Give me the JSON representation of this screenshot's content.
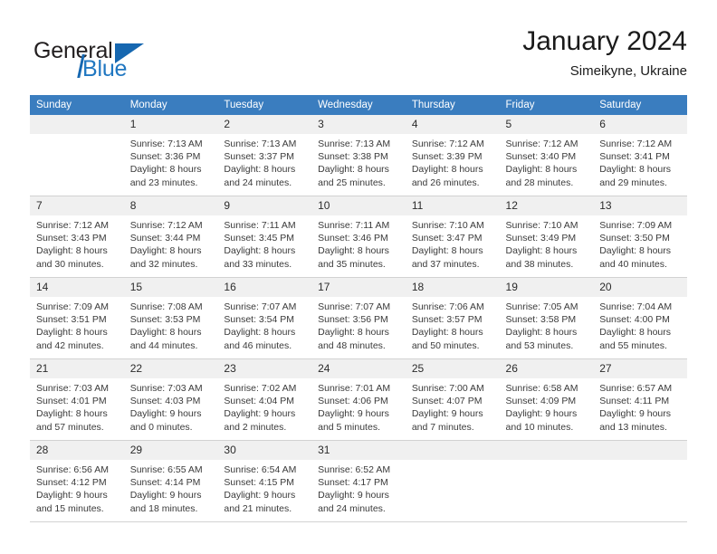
{
  "brand": {
    "name_top": "General",
    "name_bottom": "Blue",
    "accent_color": "#1667b0"
  },
  "header": {
    "title": "January 2024",
    "subtitle": "Simeikyne, Ukraine"
  },
  "theme": {
    "header_row_bg": "#3a7dbf",
    "daynum_bg": "#f0f0f0",
    "grid_line": "#d2d2d2"
  },
  "weekday_headers": [
    "Sunday",
    "Monday",
    "Tuesday",
    "Wednesday",
    "Thursday",
    "Friday",
    "Saturday"
  ],
  "weeks": [
    [
      {
        "day": "",
        "lines": []
      },
      {
        "day": "1",
        "lines": [
          "Sunrise: 7:13 AM",
          "Sunset: 3:36 PM",
          "Daylight: 8 hours",
          "and 23 minutes."
        ]
      },
      {
        "day": "2",
        "lines": [
          "Sunrise: 7:13 AM",
          "Sunset: 3:37 PM",
          "Daylight: 8 hours",
          "and 24 minutes."
        ]
      },
      {
        "day": "3",
        "lines": [
          "Sunrise: 7:13 AM",
          "Sunset: 3:38 PM",
          "Daylight: 8 hours",
          "and 25 minutes."
        ]
      },
      {
        "day": "4",
        "lines": [
          "Sunrise: 7:12 AM",
          "Sunset: 3:39 PM",
          "Daylight: 8 hours",
          "and 26 minutes."
        ]
      },
      {
        "day": "5",
        "lines": [
          "Sunrise: 7:12 AM",
          "Sunset: 3:40 PM",
          "Daylight: 8 hours",
          "and 28 minutes."
        ]
      },
      {
        "day": "6",
        "lines": [
          "Sunrise: 7:12 AM",
          "Sunset: 3:41 PM",
          "Daylight: 8 hours",
          "and 29 minutes."
        ]
      }
    ],
    [
      {
        "day": "7",
        "lines": [
          "Sunrise: 7:12 AM",
          "Sunset: 3:43 PM",
          "Daylight: 8 hours",
          "and 30 minutes."
        ]
      },
      {
        "day": "8",
        "lines": [
          "Sunrise: 7:12 AM",
          "Sunset: 3:44 PM",
          "Daylight: 8 hours",
          "and 32 minutes."
        ]
      },
      {
        "day": "9",
        "lines": [
          "Sunrise: 7:11 AM",
          "Sunset: 3:45 PM",
          "Daylight: 8 hours",
          "and 33 minutes."
        ]
      },
      {
        "day": "10",
        "lines": [
          "Sunrise: 7:11 AM",
          "Sunset: 3:46 PM",
          "Daylight: 8 hours",
          "and 35 minutes."
        ]
      },
      {
        "day": "11",
        "lines": [
          "Sunrise: 7:10 AM",
          "Sunset: 3:47 PM",
          "Daylight: 8 hours",
          "and 37 minutes."
        ]
      },
      {
        "day": "12",
        "lines": [
          "Sunrise: 7:10 AM",
          "Sunset: 3:49 PM",
          "Daylight: 8 hours",
          "and 38 minutes."
        ]
      },
      {
        "day": "13",
        "lines": [
          "Sunrise: 7:09 AM",
          "Sunset: 3:50 PM",
          "Daylight: 8 hours",
          "and 40 minutes."
        ]
      }
    ],
    [
      {
        "day": "14",
        "lines": [
          "Sunrise: 7:09 AM",
          "Sunset: 3:51 PM",
          "Daylight: 8 hours",
          "and 42 minutes."
        ]
      },
      {
        "day": "15",
        "lines": [
          "Sunrise: 7:08 AM",
          "Sunset: 3:53 PM",
          "Daylight: 8 hours",
          "and 44 minutes."
        ]
      },
      {
        "day": "16",
        "lines": [
          "Sunrise: 7:07 AM",
          "Sunset: 3:54 PM",
          "Daylight: 8 hours",
          "and 46 minutes."
        ]
      },
      {
        "day": "17",
        "lines": [
          "Sunrise: 7:07 AM",
          "Sunset: 3:56 PM",
          "Daylight: 8 hours",
          "and 48 minutes."
        ]
      },
      {
        "day": "18",
        "lines": [
          "Sunrise: 7:06 AM",
          "Sunset: 3:57 PM",
          "Daylight: 8 hours",
          "and 50 minutes."
        ]
      },
      {
        "day": "19",
        "lines": [
          "Sunrise: 7:05 AM",
          "Sunset: 3:58 PM",
          "Daylight: 8 hours",
          "and 53 minutes."
        ]
      },
      {
        "day": "20",
        "lines": [
          "Sunrise: 7:04 AM",
          "Sunset: 4:00 PM",
          "Daylight: 8 hours",
          "and 55 minutes."
        ]
      }
    ],
    [
      {
        "day": "21",
        "lines": [
          "Sunrise: 7:03 AM",
          "Sunset: 4:01 PM",
          "Daylight: 8 hours",
          "and 57 minutes."
        ]
      },
      {
        "day": "22",
        "lines": [
          "Sunrise: 7:03 AM",
          "Sunset: 4:03 PM",
          "Daylight: 9 hours",
          "and 0 minutes."
        ]
      },
      {
        "day": "23",
        "lines": [
          "Sunrise: 7:02 AM",
          "Sunset: 4:04 PM",
          "Daylight: 9 hours",
          "and 2 minutes."
        ]
      },
      {
        "day": "24",
        "lines": [
          "Sunrise: 7:01 AM",
          "Sunset: 4:06 PM",
          "Daylight: 9 hours",
          "and 5 minutes."
        ]
      },
      {
        "day": "25",
        "lines": [
          "Sunrise: 7:00 AM",
          "Sunset: 4:07 PM",
          "Daylight: 9 hours",
          "and 7 minutes."
        ]
      },
      {
        "day": "26",
        "lines": [
          "Sunrise: 6:58 AM",
          "Sunset: 4:09 PM",
          "Daylight: 9 hours",
          "and 10 minutes."
        ]
      },
      {
        "day": "27",
        "lines": [
          "Sunrise: 6:57 AM",
          "Sunset: 4:11 PM",
          "Daylight: 9 hours",
          "and 13 minutes."
        ]
      }
    ],
    [
      {
        "day": "28",
        "lines": [
          "Sunrise: 6:56 AM",
          "Sunset: 4:12 PM",
          "Daylight: 9 hours",
          "and 15 minutes."
        ]
      },
      {
        "day": "29",
        "lines": [
          "Sunrise: 6:55 AM",
          "Sunset: 4:14 PM",
          "Daylight: 9 hours",
          "and 18 minutes."
        ]
      },
      {
        "day": "30",
        "lines": [
          "Sunrise: 6:54 AM",
          "Sunset: 4:15 PM",
          "Daylight: 9 hours",
          "and 21 minutes."
        ]
      },
      {
        "day": "31",
        "lines": [
          "Sunrise: 6:52 AM",
          "Sunset: 4:17 PM",
          "Daylight: 9 hours",
          "and 24 minutes."
        ]
      },
      {
        "day": "",
        "lines": []
      },
      {
        "day": "",
        "lines": []
      },
      {
        "day": "",
        "lines": []
      }
    ]
  ]
}
